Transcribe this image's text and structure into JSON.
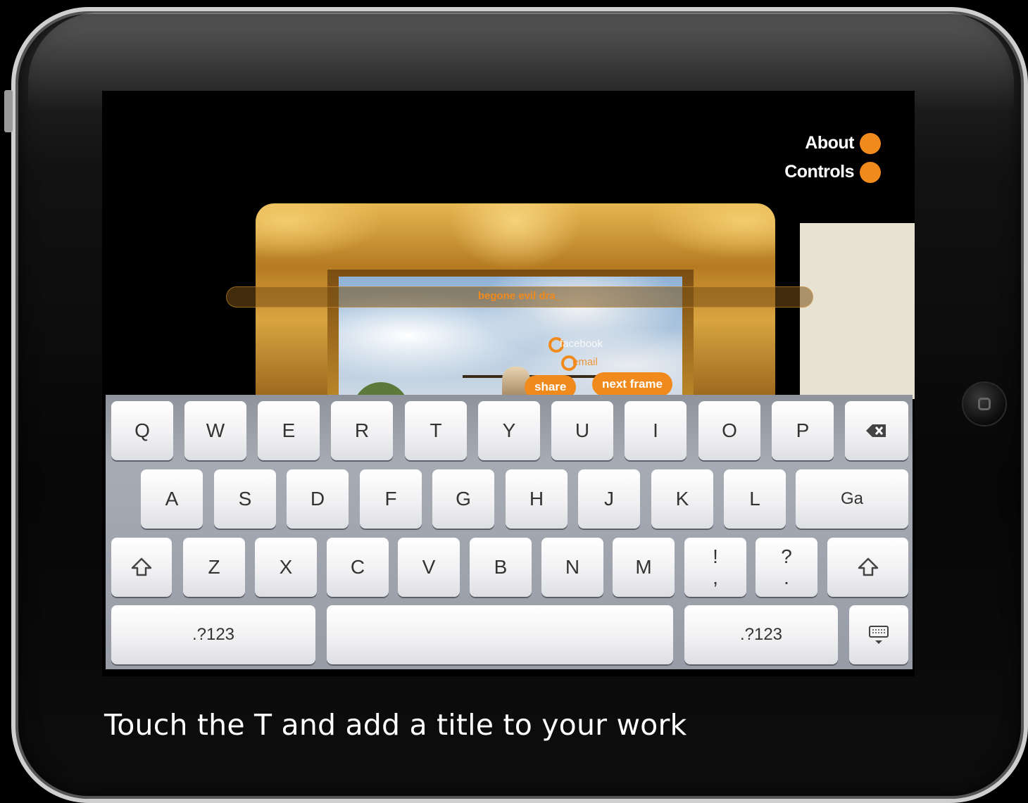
{
  "app": {
    "menu": [
      {
        "label": "About"
      },
      {
        "label": "Controls"
      }
    ],
    "title_field": {
      "value": "begone evil dra_"
    },
    "controls": {
      "facebook_label": "facebook",
      "email_label": "email",
      "share_label": "share",
      "next_frame_label": "next frame"
    },
    "accent_color": "#f08a1c"
  },
  "keyboard": {
    "row1": [
      "Q",
      "W",
      "E",
      "R",
      "T",
      "Y",
      "U",
      "I",
      "O",
      "P"
    ],
    "row2": [
      "A",
      "S",
      "D",
      "F",
      "G",
      "H",
      "J",
      "K",
      "L"
    ],
    "go_label": "Ga",
    "row3": [
      "Z",
      "X",
      "C",
      "V",
      "B",
      "N",
      "M"
    ],
    "punct1": {
      "top": "!",
      "bottom": ","
    },
    "punct2": {
      "top": "?",
      "bottom": "."
    },
    "numbers_label": ".?123",
    "space_label": "",
    "icons": {
      "backspace": "backspace-icon",
      "shift": "shift-icon",
      "hide": "keyboard-hide-icon"
    }
  },
  "caption": "Touch the T and add a title to your work"
}
